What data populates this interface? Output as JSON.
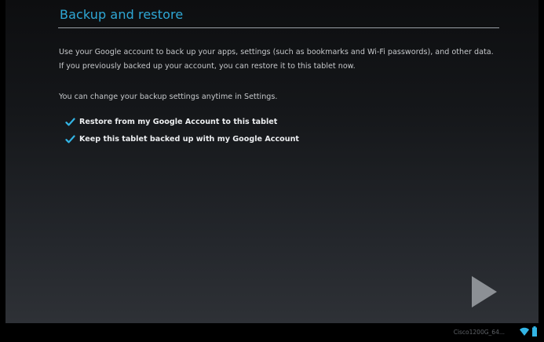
{
  "page": {
    "title": "Backup and restore",
    "description_line1": "Use your Google account to back up your apps, settings (such as bookmarks and Wi-Fi passwords), and other data.",
    "description_line2": "If you previously backed up your account, you can restore it to this tablet now.",
    "settings_note": "You can change your backup settings anytime in Settings."
  },
  "options": [
    {
      "label": "Restore from my Google Account to this tablet",
      "checked": true
    },
    {
      "label": "Keep this tablet backed up with my Google Account",
      "checked": true
    }
  ],
  "navigation": {
    "next_icon": "play-arrow-icon"
  },
  "status_bar": {
    "network_name": "Cisco1200G_64...",
    "wifi_icon": "wifi-icon",
    "battery_icon": "battery-icon"
  },
  "colors": {
    "accent": "#2fa8d6",
    "status_icon": "#33b5e5"
  }
}
